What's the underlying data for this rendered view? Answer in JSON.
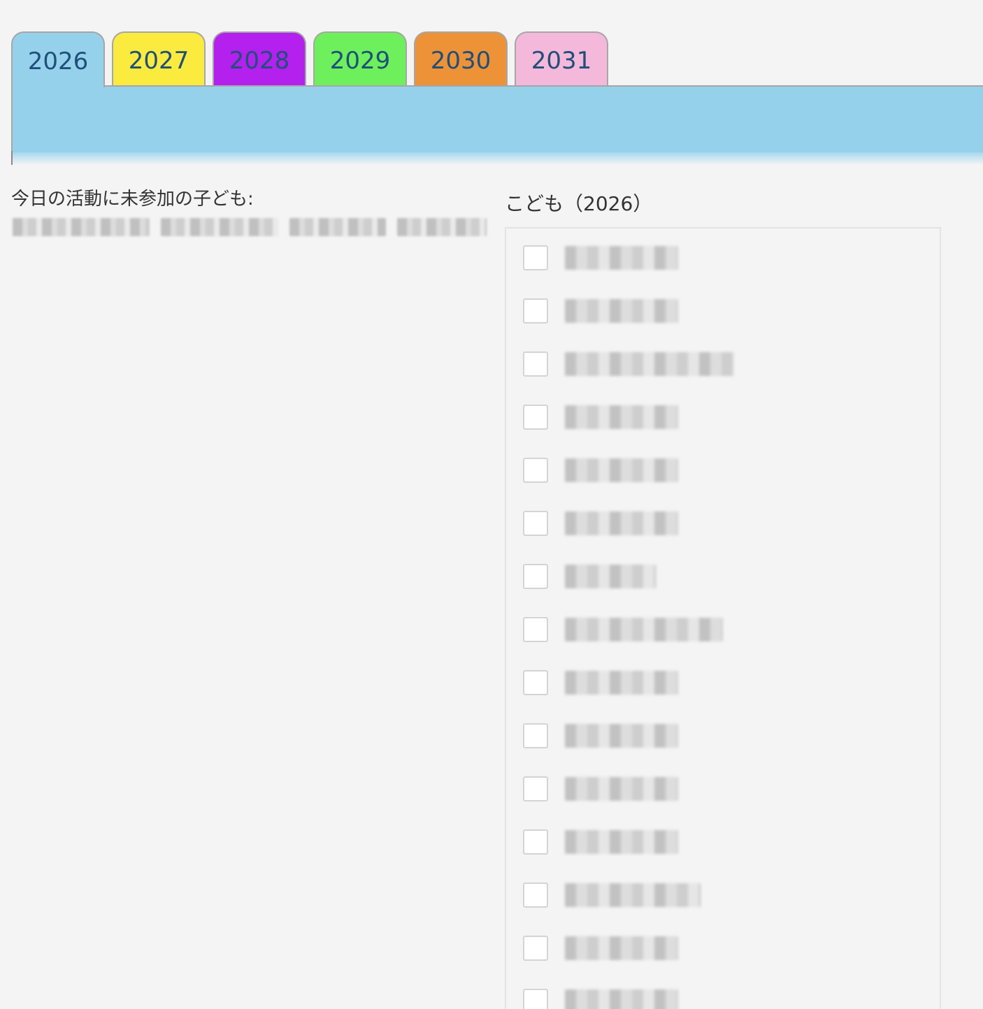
{
  "tabs": [
    {
      "label": "2026",
      "color": "#96d1ec",
      "active": true
    },
    {
      "label": "2027",
      "color": "#fbeb3f",
      "active": false
    },
    {
      "label": "2028",
      "color": "#b420ee",
      "active": false
    },
    {
      "label": "2029",
      "color": "#6df05c",
      "active": false
    },
    {
      "label": "2030",
      "color": "#ee9238",
      "active": false
    },
    {
      "label": "2031",
      "color": "#f4b8da",
      "active": false
    }
  ],
  "panel": {
    "color": "#96d1ec"
  },
  "absent": {
    "label": "今日の活動に未参加の子ども:"
  },
  "children_list": {
    "title": "こども（2026）",
    "rows": [
      {
        "checked": false
      },
      {
        "checked": false
      },
      {
        "checked": false
      },
      {
        "checked": false
      },
      {
        "checked": false
      },
      {
        "checked": false
      },
      {
        "checked": false
      },
      {
        "checked": false
      },
      {
        "checked": false
      },
      {
        "checked": false
      },
      {
        "checked": false
      },
      {
        "checked": false
      },
      {
        "checked": false
      },
      {
        "checked": false
      },
      {
        "checked": false
      }
    ]
  }
}
